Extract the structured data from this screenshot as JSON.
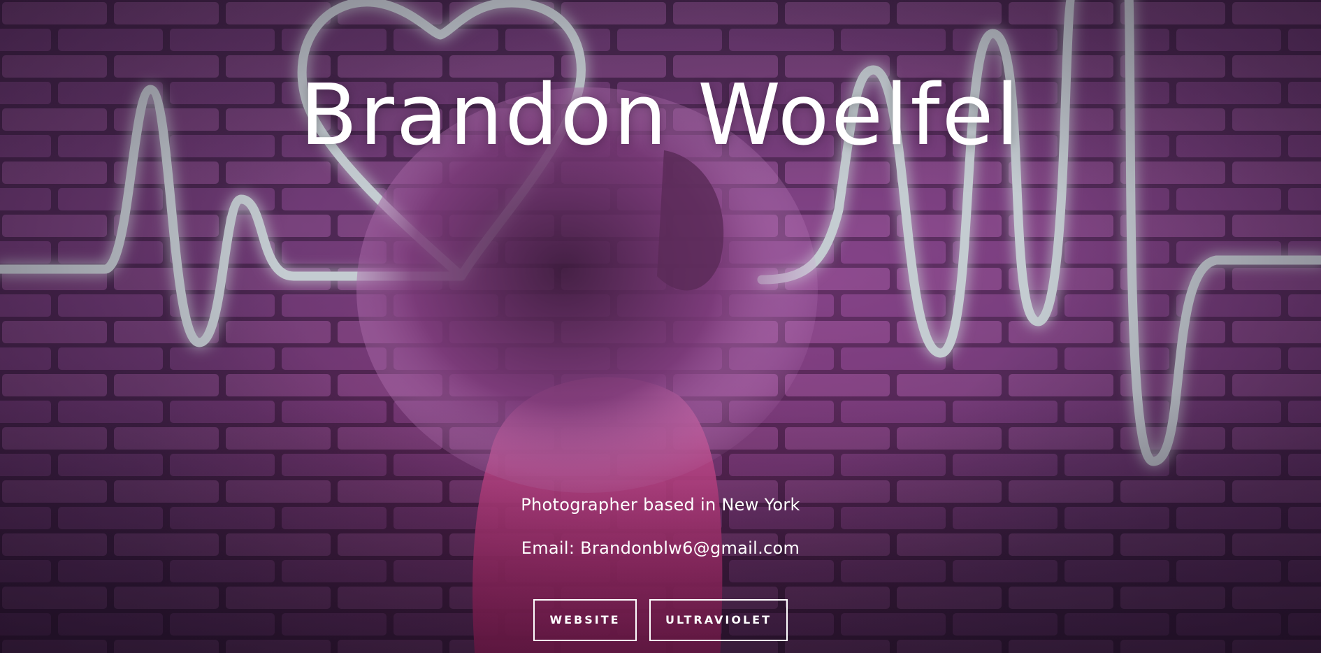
{
  "hero": {
    "title": "Brandon Woelfel",
    "tagline": "Photographer based in New York",
    "email": "Email: Brandonblw6@gmail.com",
    "background_image": "neon-heartbeat-brick-wall-photo",
    "accent_color": "#b7c2c7"
  },
  "buttons": {
    "website_label": "WEBSITE",
    "ultraviolet_label": "ULTRAVIOLET"
  }
}
